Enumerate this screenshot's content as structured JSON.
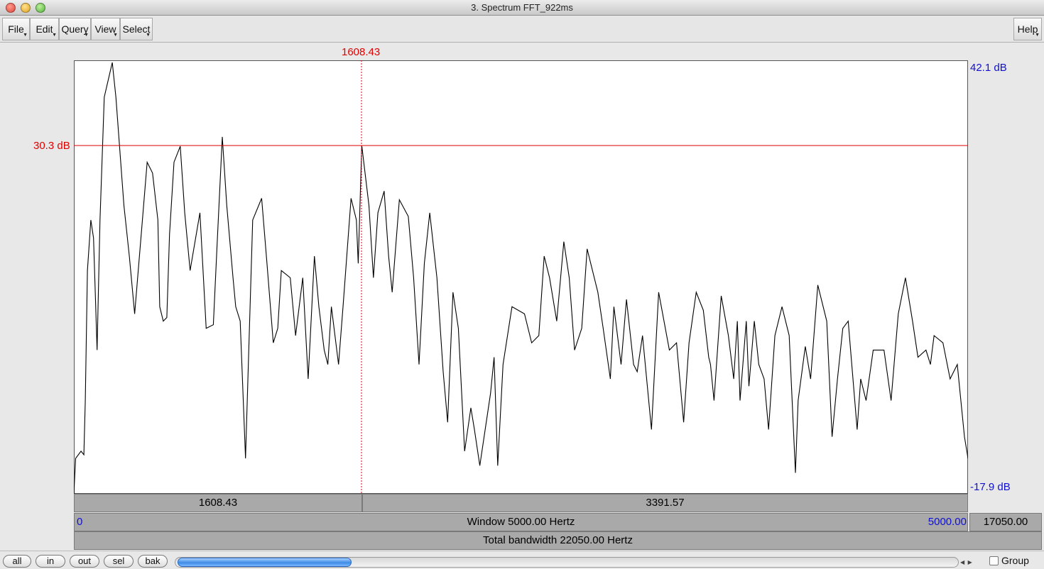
{
  "window": {
    "title": "3. Spectrum FFT_922ms"
  },
  "menus": {
    "file": "File",
    "edit": "Edit",
    "query": "Query",
    "view": "View",
    "select": "Select",
    "help": "Help"
  },
  "cursor": {
    "frequency_label": "1608.43",
    "level_label": "30.3 dB",
    "frequency": 1608.43,
    "level_db": 30.3
  },
  "axis": {
    "top_db_label": "42.1 dB",
    "bottom_db_label": "-17.9 dB",
    "left_freq_label": "0",
    "right_freq_label": "5000.00"
  },
  "bars": {
    "left_segment": "1608.43",
    "right_segment": "3391.57",
    "window": "Window 5000.00 Hertz",
    "window_right": "17050.00",
    "total": "Total bandwidth 22050.00 Hertz"
  },
  "bottom": {
    "all": "all",
    "in": "in",
    "out": "out",
    "sel": "sel",
    "bak": "bak",
    "group_label": "Group",
    "group_checked": false
  },
  "colors": {
    "cursor": "#e00000",
    "axis_blue": "#1010d0",
    "scroll_thumb": "#3e8be5"
  },
  "chart_data": {
    "type": "line",
    "xlim": [
      0,
      5000
    ],
    "ylim": [
      -17.9,
      42.1
    ],
    "xlabel": "",
    "ylabel": "",
    "points": [
      [
        0,
        -17.9
      ],
      [
        10,
        -13
      ],
      [
        40,
        -12
      ],
      [
        56,
        -12.5
      ],
      [
        64,
        -5
      ],
      [
        76,
        13
      ],
      [
        95,
        20
      ],
      [
        110,
        17.5
      ],
      [
        130,
        2
      ],
      [
        146,
        20
      ],
      [
        170,
        37
      ],
      [
        215,
        41.8
      ],
      [
        235,
        37
      ],
      [
        280,
        22
      ],
      [
        310,
        15
      ],
      [
        340,
        7
      ],
      [
        380,
        19
      ],
      [
        410,
        28
      ],
      [
        440,
        26.5
      ],
      [
        470,
        20
      ],
      [
        480,
        8
      ],
      [
        500,
        6
      ],
      [
        520,
        6.5
      ],
      [
        535,
        18
      ],
      [
        560,
        28
      ],
      [
        595,
        30.2
      ],
      [
        620,
        21
      ],
      [
        650,
        13
      ],
      [
        705,
        21
      ],
      [
        740,
        5
      ],
      [
        780,
        5.5
      ],
      [
        800,
        16
      ],
      [
        830,
        31.5
      ],
      [
        855,
        22
      ],
      [
        890,
        12
      ],
      [
        905,
        8
      ],
      [
        930,
        6
      ],
      [
        960,
        -13
      ],
      [
        1000,
        20
      ],
      [
        1050,
        23
      ],
      [
        1080,
        14
      ],
      [
        1115,
        3
      ],
      [
        1140,
        5
      ],
      [
        1160,
        13
      ],
      [
        1210,
        12
      ],
      [
        1240,
        4
      ],
      [
        1280,
        12
      ],
      [
        1310,
        -2
      ],
      [
        1345,
        15
      ],
      [
        1370,
        8
      ],
      [
        1400,
        2
      ],
      [
        1420,
        0
      ],
      [
        1440,
        8
      ],
      [
        1480,
        0
      ],
      [
        1505,
        8
      ],
      [
        1550,
        23
      ],
      [
        1580,
        20
      ],
      [
        1590,
        14
      ],
      [
        1610,
        30.3
      ],
      [
        1650,
        22
      ],
      [
        1675,
        12
      ],
      [
        1700,
        21
      ],
      [
        1735,
        24
      ],
      [
        1760,
        15
      ],
      [
        1780,
        10
      ],
      [
        1820,
        22.8
      ],
      [
        1870,
        20.5
      ],
      [
        1900,
        12
      ],
      [
        1930,
        0
      ],
      [
        1960,
        14
      ],
      [
        1990,
        21
      ],
      [
        2030,
        12
      ],
      [
        2065,
        -1
      ],
      [
        2090,
        -8
      ],
      [
        2120,
        10
      ],
      [
        2150,
        5
      ],
      [
        2185,
        -12
      ],
      [
        2220,
        -6
      ],
      [
        2240,
        -9
      ],
      [
        2270,
        -14
      ],
      [
        2330,
        -4
      ],
      [
        2350,
        1
      ],
      [
        2370,
        -14
      ],
      [
        2400,
        0
      ],
      [
        2450,
        8
      ],
      [
        2520,
        7
      ],
      [
        2560,
        3
      ],
      [
        2600,
        4
      ],
      [
        2630,
        15
      ],
      [
        2660,
        12
      ],
      [
        2700,
        6
      ],
      [
        2740,
        17
      ],
      [
        2770,
        12
      ],
      [
        2800,
        2
      ],
      [
        2840,
        5
      ],
      [
        2870,
        16
      ],
      [
        2930,
        10
      ],
      [
        2960,
        5
      ],
      [
        3000,
        -2
      ],
      [
        3020,
        8
      ],
      [
        3060,
        0
      ],
      [
        3090,
        9
      ],
      [
        3130,
        0
      ],
      [
        3150,
        -1
      ],
      [
        3180,
        4
      ],
      [
        3230,
        -9
      ],
      [
        3270,
        10
      ],
      [
        3330,
        2
      ],
      [
        3370,
        3
      ],
      [
        3410,
        -8
      ],
      [
        3440,
        3
      ],
      [
        3480,
        10
      ],
      [
        3520,
        7.5
      ],
      [
        3550,
        1
      ],
      [
        3560,
        0
      ],
      [
        3580,
        -5
      ],
      [
        3620,
        9.5
      ],
      [
        3660,
        4
      ],
      [
        3690,
        -2
      ],
      [
        3710,
        6
      ],
      [
        3725,
        -5
      ],
      [
        3760,
        6
      ],
      [
        3775,
        -3
      ],
      [
        3805,
        6
      ],
      [
        3830,
        0
      ],
      [
        3860,
        -2
      ],
      [
        3885,
        -9
      ],
      [
        3920,
        4
      ],
      [
        3960,
        8
      ],
      [
        4000,
        4
      ],
      [
        4035,
        -15
      ],
      [
        4050,
        -5
      ],
      [
        4090,
        2.5
      ],
      [
        4120,
        -2
      ],
      [
        4160,
        11
      ],
      [
        4210,
        6
      ],
      [
        4240,
        -10
      ],
      [
        4270,
        -2
      ],
      [
        4300,
        5
      ],
      [
        4330,
        6
      ],
      [
        4380,
        -9
      ],
      [
        4400,
        -2
      ],
      [
        4430,
        -5
      ],
      [
        4470,
        2
      ],
      [
        4530,
        2
      ],
      [
        4570,
        -5
      ],
      [
        4610,
        7
      ],
      [
        4650,
        12
      ],
      [
        4690,
        6
      ],
      [
        4720,
        1
      ],
      [
        4765,
        2
      ],
      [
        4790,
        0
      ],
      [
        4810,
        4
      ],
      [
        4860,
        3
      ],
      [
        4900,
        -2
      ],
      [
        4940,
        0
      ],
      [
        4980,
        -10
      ],
      [
        5000,
        -13
      ]
    ]
  }
}
